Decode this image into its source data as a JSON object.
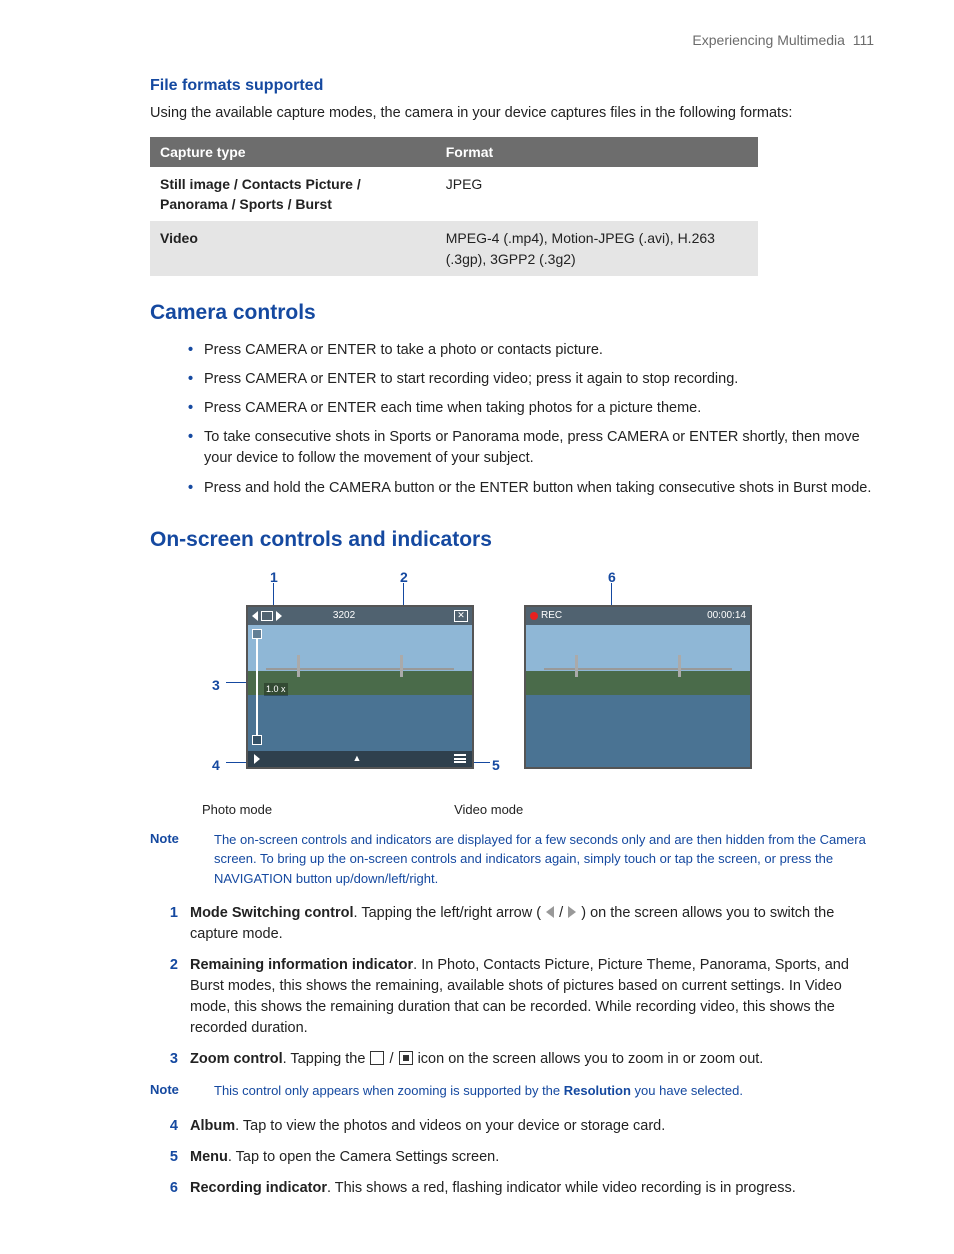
{
  "header": {
    "section": "Experiencing Multimedia",
    "page": "111"
  },
  "file_formats": {
    "title": "File formats supported",
    "intro": "Using the available capture modes, the camera in your device captures files in the following formats:",
    "cols": {
      "c1": "Capture type",
      "c2": "Format"
    },
    "rows": [
      {
        "cap": "Still image / Contacts Picture / Panorama / Sports / Burst",
        "fmt": "JPEG"
      },
      {
        "cap": "Video",
        "fmt": "MPEG-4 (.mp4), Motion-JPEG (.avi), H.263 (.3gp), 3GPP2 (.3g2)"
      }
    ]
  },
  "camera_controls": {
    "title": "Camera controls",
    "items": [
      "Press CAMERA or ENTER to take a photo or contacts picture.",
      "Press CAMERA or ENTER to start recording video; press it again to stop recording.",
      "Press CAMERA or ENTER each time when taking photos for a picture theme.",
      "To take consecutive shots in Sports or Panorama mode, press CAMERA or ENTER shortly, then move your device to follow the movement of your subject.",
      "Press and hold the CAMERA button or the ENTER button when taking consecutive shots in Burst mode."
    ]
  },
  "onscreen": {
    "title": "On-screen controls and indicators",
    "labels": {
      "n1": "1",
      "n2": "2",
      "n3": "3",
      "n4": "4",
      "n5": "5",
      "n6": "6"
    },
    "photo": {
      "remaining": "3202",
      "zoom": "1.0 x"
    },
    "video": {
      "rec": "REC",
      "time": "00:00:14"
    },
    "captions": {
      "photo": "Photo mode",
      "video": "Video mode"
    },
    "note_label": "Note",
    "note_text": "The on-screen controls and indicators are displayed for a few seconds only and are then hidden from the Camera screen. To bring up the on-screen controls and indicators again, simply touch or tap the screen, or press the NAVIGATION button up/down/left/right.",
    "entries": [
      {
        "n": "1",
        "bold": "Mode Switching control",
        "pre": ". Tapping the left/right arrow ( ",
        "post": " ) on the screen allows you to switch the capture mode.",
        "icons": "arrows"
      },
      {
        "n": "2",
        "bold": "Remaining information indicator",
        "pre": ". In Photo, Contacts Picture, Picture Theme, Panorama, Sports, and Burst modes, this shows the remaining, available shots of pictures based on current settings. In Video mode, this shows the remaining duration that can be recorded. While recording video, this shows the recorded duration.",
        "post": "",
        "icons": ""
      },
      {
        "n": "3",
        "bold": "Zoom control",
        "pre": ". Tapping the ",
        "post": " icon on the screen allows you to zoom in or zoom out.",
        "icons": "zoom"
      }
    ],
    "note2_label": "Note",
    "note2_pre": "This control only appears when zooming is supported by the ",
    "note2_kw": "Resolution",
    "note2_post": " you have selected.",
    "entries2": [
      {
        "n": "4",
        "bold": "Album",
        "pre": ". Tap to view the photos and videos on your device or storage card.",
        "post": "",
        "icons": ""
      },
      {
        "n": "5",
        "bold": "Menu",
        "pre": ". Tap to open the Camera Settings screen.",
        "post": "",
        "icons": ""
      },
      {
        "n": "6",
        "bold": "Recording indicator",
        "pre": ". This shows a red, flashing indicator while video recording is in progress.",
        "post": "",
        "icons": ""
      }
    ]
  }
}
